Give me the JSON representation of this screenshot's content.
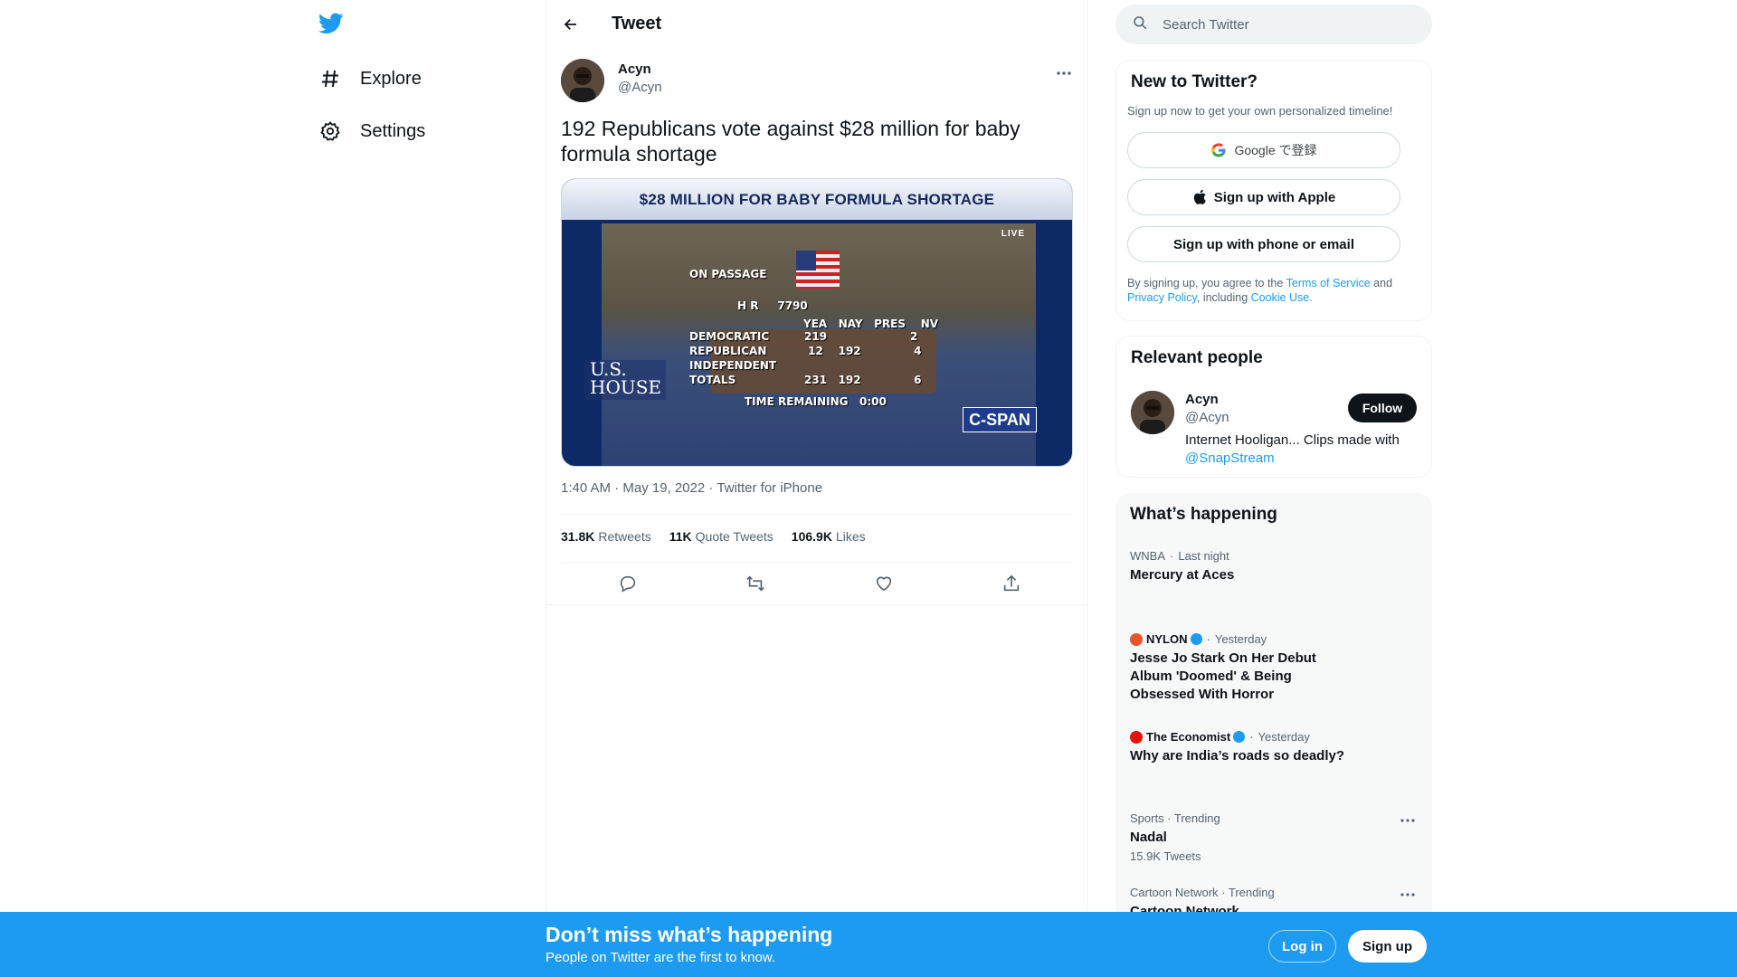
{
  "nav": {
    "items": [
      {
        "label": "Explore",
        "icon": "hashtag-icon"
      },
      {
        "label": "Settings",
        "icon": "gear-icon"
      }
    ]
  },
  "header": {
    "title": "Tweet"
  },
  "tweet": {
    "author_name": "Acyn",
    "author_handle": "@Acyn",
    "text": "192 Republicans vote against $28 million for baby formula shortage",
    "media": {
      "banner": "$28 MILLION FOR BABY FORMULA SHORTAGE",
      "live": "LIVE",
      "on_passage": "ON PASSAGE",
      "hr": "H R     7790",
      "columns": "YEA   NAY   PRES    NV",
      "rows": [
        {
          "label": "DEMOCRATIC",
          "values": "219                      2"
        },
        {
          "label": "REPUBLICAN",
          "values": " 12    192              4"
        },
        {
          "label": "INDEPENDENT",
          "values": ""
        },
        {
          "label": "TOTALS",
          "values": "231   192              6"
        }
      ],
      "time_remaining": "TIME REMAINING   0:00",
      "house_logo": "U.S. HOUSE",
      "network": "C-SPAN"
    },
    "meta": "1:40 AM · May 19, 2022 · Twitter for iPhone",
    "stats": [
      {
        "count": "31.8K",
        "label": "Retweets"
      },
      {
        "count": "11K",
        "label": "Quote Tweets"
      },
      {
        "count": "106.9K",
        "label": "Likes"
      }
    ]
  },
  "search": {
    "placeholder": "Search Twitter"
  },
  "new_to_twitter": {
    "title": "New to Twitter?",
    "subtitle": "Sign up now to get your own personalized timeline!",
    "google_button": "Google で登録",
    "apple_button": "Sign up with Apple",
    "phone_button": "Sign up with phone or email",
    "terms_pre": "By signing up, you agree to the ",
    "terms_link": "Terms of Service",
    "terms_and": " and ",
    "privacy_link": "Privacy Policy",
    "terms_including": ", including ",
    "cookie_link": "Cookie Use."
  },
  "relevant": {
    "title": "Relevant people",
    "name": "Acyn",
    "handle": "@Acyn",
    "bio": "Internet Hooligan... Clips made with ",
    "bio_link": "@SnapStream",
    "follow": "Follow"
  },
  "happening": {
    "title": "What’s happening",
    "trends": [
      {
        "context": "WNBA",
        "time": "Last night",
        "title": "Mercury at Aces"
      },
      {
        "source": "NYLON",
        "time": "Yesterday",
        "title": "Jesse Jo Stark On Her Debut Album 'Doomed' & Being Obsessed With Horror"
      },
      {
        "source": "The Economist",
        "time": "Yesterday",
        "title": "Why are India’s roads so deadly?"
      },
      {
        "context": "Sports · Trending",
        "title": "Nadal",
        "count": "15.9K Tweets"
      },
      {
        "context": "Cartoon Network · Trending",
        "title": "Cartoon Network"
      }
    ]
  },
  "bottom_bar": {
    "title": "Don’t miss what’s happening",
    "subtitle": "People on Twitter are the first to know.",
    "login": "Log in",
    "signup": "Sign up"
  },
  "colors": {
    "accent": "#1d9bf0",
    "text": "#0f1419",
    "secondary": "#536471"
  }
}
